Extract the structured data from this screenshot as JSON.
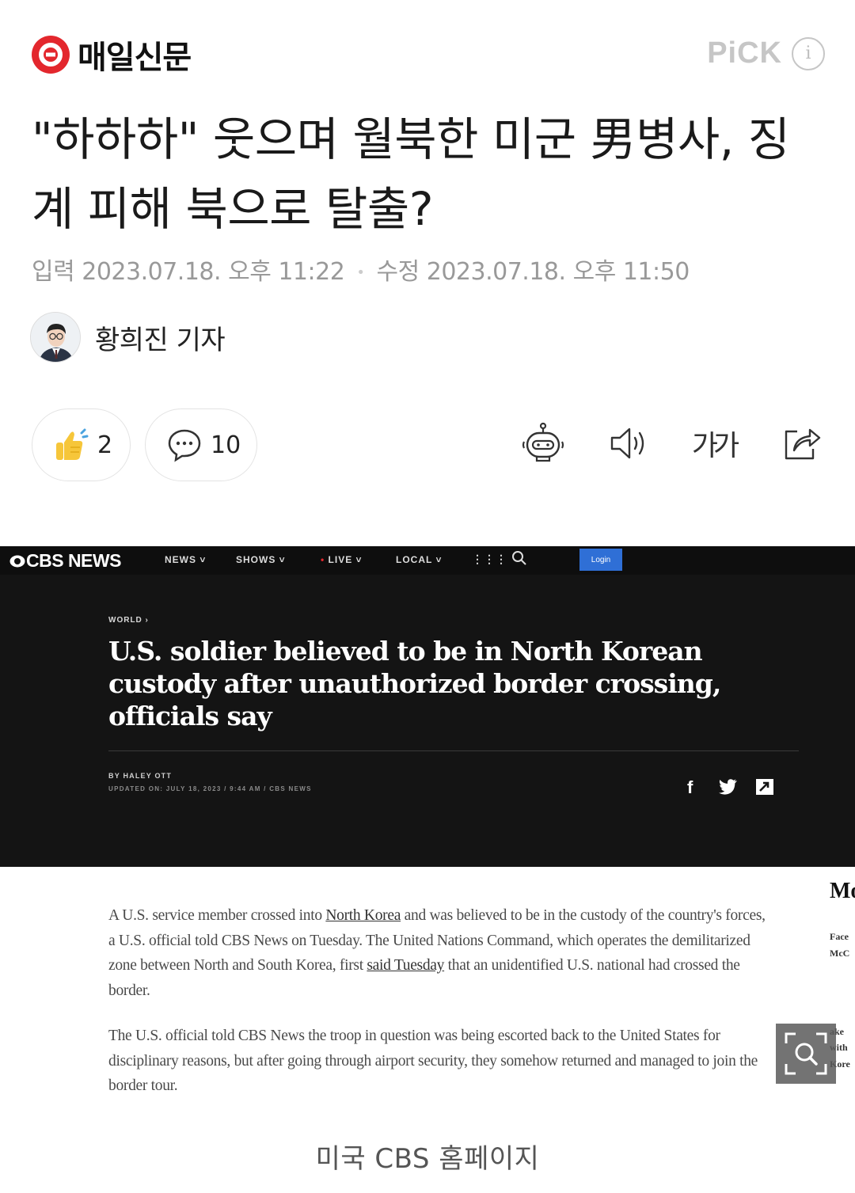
{
  "header": {
    "brand_name": "매일신문",
    "pick_label": "PiCK",
    "info_symbol": "i"
  },
  "article": {
    "title": "\"하하하\" 웃으며 월북한 미군 男병사, 징계 피해 북으로 탈출?",
    "published_label": "입력",
    "published": "2023.07.18. 오후 11:22",
    "modified_label": "수정",
    "modified": "2023.07.18. 오후 11:50",
    "author": "황희진 기자"
  },
  "actions": {
    "like_count": "2",
    "comment_count": "10",
    "font_size_label": "가가",
    "icons": [
      "thumbs-up-icon",
      "comment-icon",
      "robot-summary-icon",
      "speaker-icon",
      "font-size-icon",
      "share-icon"
    ]
  },
  "embedded_screenshot": {
    "logo": "CBS NEWS",
    "nav": [
      "NEWS",
      "SHOWS",
      "LIVE",
      "LOCAL"
    ],
    "login": "Login",
    "kicker": "WORLD",
    "headline": "U.S. soldier believed to be in North Korean custody after unauthorized border crossing, officials say",
    "byline": "BY HALEY OTT",
    "updated": "UPDATED ON: JULY 18, 2023 / 9:44 AM / CBS NEWS",
    "social": [
      "f",
      "t",
      "share"
    ],
    "paragraph1": {
      "part1": "A U.S. service member crossed into ",
      "link1": "North Korea",
      "part2": " and was believed to be in the custody of the country's forces, a U.S. official told CBS News on Tuesday. The United Nations Command, which operates the demilitarized zone between North and South Korea, first ",
      "link2": "said Tuesday",
      "part3": " that an unidentified U.S. national had crossed the border."
    },
    "paragraph2": "The U.S. official told CBS News the troop in question was being escorted back to the United States for disciplinary reasons, but after going through airport security, they somehow returned and managed to join the border tour.",
    "sidebar_title": "Mo",
    "sidebar_lines": [
      "Face",
      "McC",
      "ake",
      "with",
      "Kore"
    ]
  },
  "caption": "미국 CBS 홈페이지",
  "colors": {
    "brand_red": "#e3272d",
    "pick_gray": "#c6c6c6",
    "cbs_dark": "#141414",
    "cbs_login_blue": "#2f6fd6",
    "like_yellow": "#f6c63a"
  }
}
